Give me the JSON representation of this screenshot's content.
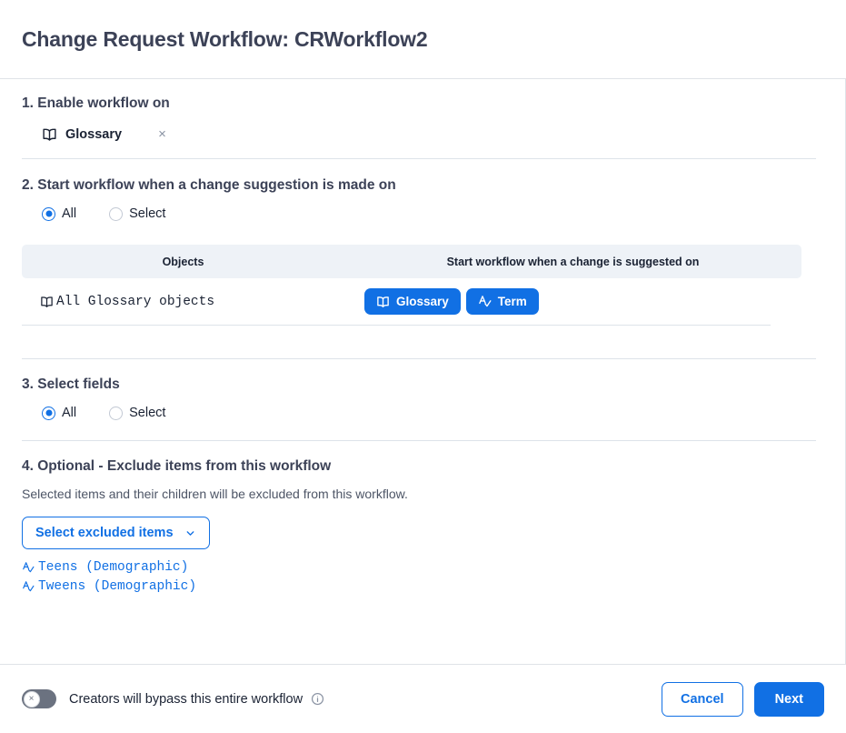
{
  "header": {
    "title": "Change Request Workflow: CRWorkflow2"
  },
  "colors": {
    "accent_blue": "#1170e4",
    "title_gray": "#3c4257",
    "table_header_bg": "#eef2f7",
    "divider": "#dde3e9",
    "toggle_off": "#6b7280"
  },
  "sections": {
    "step1": {
      "title": "1. Enable workflow on",
      "chip": {
        "icon": "book-icon",
        "label": "Glossary",
        "remove_label": "×"
      }
    },
    "step2": {
      "title": "2. Start workflow when a change suggestion is made on",
      "radios": [
        {
          "label": "All",
          "checked": true
        },
        {
          "label": "Select",
          "checked": false
        }
      ],
      "table": {
        "columns": [
          "Objects",
          "Start workflow when a change is suggested on"
        ],
        "rows": [
          {
            "object_icon": "book-icon",
            "object": "All Glossary objects",
            "pills": [
              {
                "icon": "book-icon",
                "label": "Glossary"
              },
              {
                "icon": "term-icon",
                "label": "Term"
              }
            ]
          }
        ]
      }
    },
    "step3": {
      "title": "3. Select fields",
      "radios": [
        {
          "label": "All",
          "checked": true
        },
        {
          "label": "Select",
          "checked": false
        }
      ]
    },
    "step4": {
      "title": "4. Optional - Exclude items from this workflow",
      "description": "Selected items and their children will be excluded from this workflow.",
      "dropdown_label": "Select excluded items",
      "dropdown_icon": "chevron-down-icon",
      "excluded_items": [
        {
          "icon": "term-icon",
          "label": "Teens (Demographic)"
        },
        {
          "icon": "term-icon",
          "label": "Tweens (Demographic)"
        }
      ]
    }
  },
  "footer": {
    "toggle": {
      "state_icon": "×",
      "on": false
    },
    "toggle_label": "Creators will bypass this entire workflow",
    "info_icon": "info-icon",
    "cancel_label": "Cancel",
    "next_label": "Next"
  }
}
